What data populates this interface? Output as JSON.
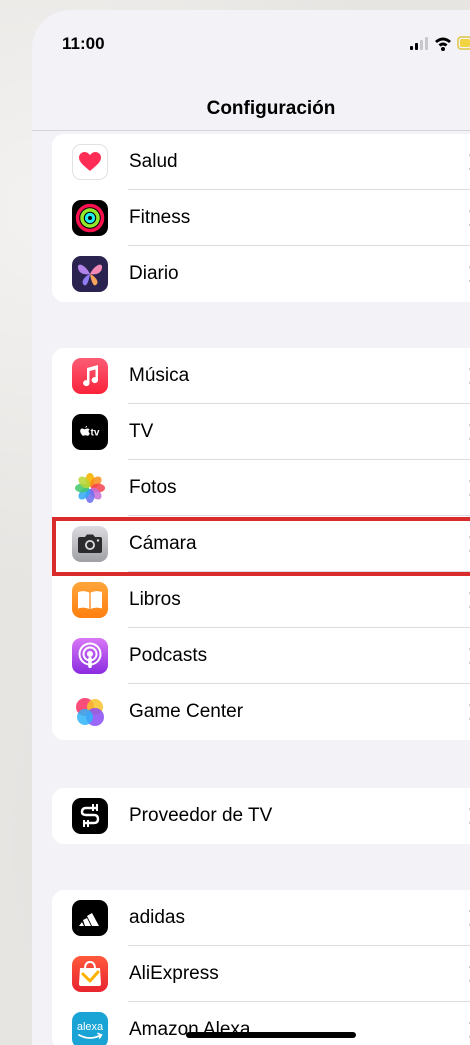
{
  "status_bar": {
    "time": "11:00"
  },
  "header": {
    "title": "Configuración"
  },
  "groups": [
    {
      "items": [
        {
          "label": "Salud",
          "icon": "health-heart-icon"
        },
        {
          "label": "Fitness",
          "icon": "fitness-rings-icon"
        },
        {
          "label": "Diario",
          "icon": "journal-butterfly-icon"
        }
      ]
    },
    {
      "items": [
        {
          "label": "Música",
          "icon": "music-note-icon"
        },
        {
          "label": "TV",
          "icon": "apple-tv-icon",
          "icon_text": "tv"
        },
        {
          "label": "Fotos",
          "icon": "photos-flower-icon"
        },
        {
          "label": "Cámara",
          "icon": "camera-icon",
          "highlighted": true
        },
        {
          "label": "Libros",
          "icon": "books-icon"
        },
        {
          "label": "Podcasts",
          "icon": "podcasts-icon"
        },
        {
          "label": "Game Center",
          "icon": "game-center-icon"
        }
      ]
    },
    {
      "items": [
        {
          "label": "Proveedor de TV",
          "icon": "tv-provider-icon"
        }
      ]
    },
    {
      "items": [
        {
          "label": "adidas",
          "icon": "adidas-logo-icon"
        },
        {
          "label": "AliExpress",
          "icon": "aliexpress-bag-icon"
        },
        {
          "label": "Amazon Alexa",
          "icon": "alexa-icon",
          "icon_text": "alexa"
        }
      ]
    }
  ],
  "colors": {
    "highlight_border": "#d92b2b",
    "background": "#f2f2f7",
    "chevron": "#c4c4c7"
  }
}
